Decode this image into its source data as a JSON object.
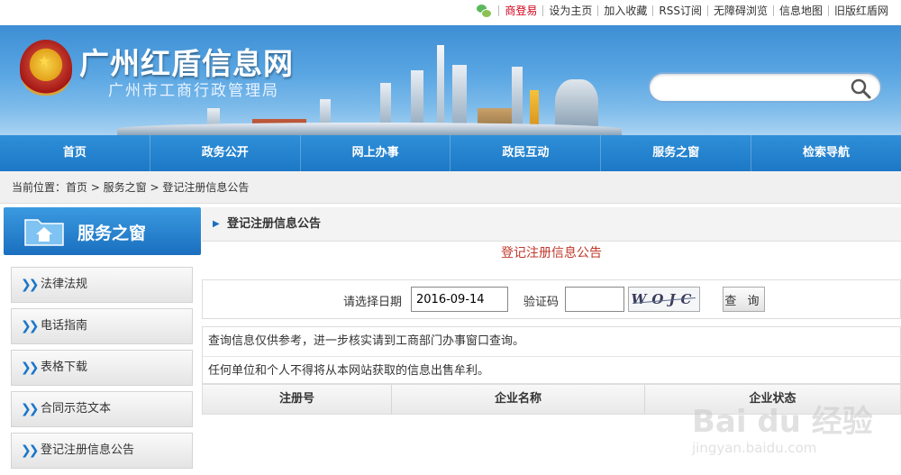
{
  "topbar": {
    "links": [
      "商登易",
      "设为主页",
      "加入收藏",
      "RSS订阅",
      "无障碍浏览",
      "信息地图",
      "旧版红盾网"
    ]
  },
  "header": {
    "site_title": "广州红盾信息网",
    "site_subtitle": "广州市工商行政管理局",
    "search_placeholder": ""
  },
  "nav": {
    "items": [
      "首页",
      "政务公开",
      "网上办事",
      "政民互动",
      "服务之窗",
      "检索导航"
    ]
  },
  "breadcrumb": {
    "text": "当前位置：首页 > 服务之窗 > 登记注册信息公告"
  },
  "sidebar": {
    "title": "服务之窗",
    "items": [
      "法律法规",
      "电话指南",
      "表格下载",
      "合同示范文本",
      "登记注册信息公告"
    ]
  },
  "main": {
    "section_title": "登记注册信息公告",
    "notice_title": "登记注册信息公告",
    "query": {
      "date_label": "请选择日期",
      "date_value": "2016-09-14",
      "code_label": "验证码",
      "code_value": "",
      "captcha_text": "WOJC",
      "submit_label": "查 询"
    },
    "info_lines": [
      "查询信息仅供参考，进一步核实请到工商部门办事窗口查询。",
      "任何单位和个人不得将从本网站获取的信息出售牟利。"
    ],
    "table_headers": [
      "注册号",
      "企业名称",
      "企业状态"
    ]
  },
  "watermark": {
    "logo": "Bai du 经验",
    "url": "jingyan.baidu.com"
  }
}
